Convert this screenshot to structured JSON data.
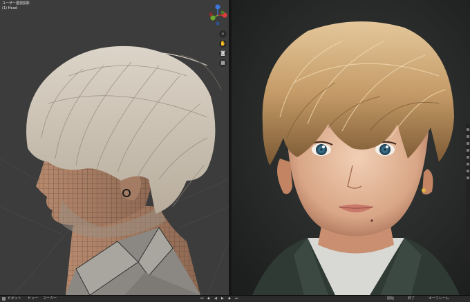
{
  "left_viewport": {
    "mode_text": "ユーザー透視投影",
    "object_text": "(1) Head"
  },
  "gizmo": {
    "axes": [
      "Z",
      "Y",
      "X"
    ],
    "colors": {
      "x": "#e03a3a",
      "y": "#6aa82e",
      "z": "#3d77d8"
    }
  },
  "nav_buttons": [
    "zoom-icon",
    "hand-pan-icon",
    "camera-icon",
    "grid-icon"
  ],
  "status_bar": {
    "left_items": [
      "ピボット",
      "ビュー",
      "マーカー"
    ],
    "right_items": [
      "開始",
      "終了",
      "キーフレーム"
    ],
    "playback_icons": [
      "jump-start-icon",
      "prev-key-icon",
      "play-reverse-icon",
      "play-icon",
      "next-key-icon",
      "jump-end-icon"
    ]
  },
  "colors": {
    "viewport_left_bg": "#3c3c3c",
    "viewport_right_bg": "#2a2c2b",
    "ui_dark": "#2b2b2b"
  }
}
